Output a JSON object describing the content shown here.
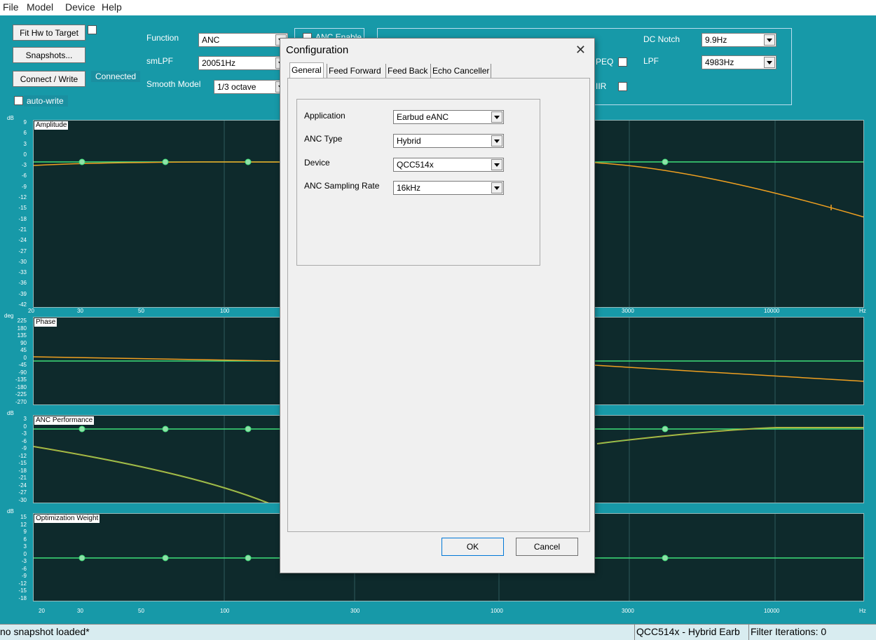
{
  "menubar": {
    "items": [
      "File",
      "Model",
      "Device",
      "Help"
    ]
  },
  "toolbar": {
    "fit_hw_label": "Fit Hw to Target",
    "snapshots_label": "Snapshots...",
    "connect_label": "Connect / Write",
    "connected_text": "Connected",
    "auto_write_label": "auto-write",
    "function_label": "Function",
    "function_value": "ANC",
    "smlpf_label": "smLPF",
    "smlpf_value": "20051Hz",
    "smooth_label": "Smooth Model",
    "smooth_value": "1/3 octave",
    "anc_enable_label": "ANC Enable",
    "peq_label": "PEQ",
    "iir_label": "IIR",
    "dc_notch_label": "DC Notch",
    "dc_notch_value": "9.9Hz",
    "lpf_label": "LPF",
    "lpf_value": "4983Hz"
  },
  "plots": {
    "amplitude": {
      "title": "Amplitude",
      "unit": "dB",
      "yticks": [
        "9",
        "6",
        "3",
        "0",
        "-3",
        "-6",
        "-9",
        "-12",
        "-15",
        "-18",
        "-21",
        "-24",
        "-27",
        "-30",
        "-33",
        "-36",
        "-39",
        "-42"
      ]
    },
    "phase": {
      "title": "Phase",
      "unit": "deg",
      "yticks": [
        "225",
        "180",
        "135",
        "90",
        "45",
        "0",
        "-45",
        "-90",
        "-135",
        "-180",
        "-225",
        "-270"
      ]
    },
    "anc": {
      "title": "ANC Performance",
      "unit": "dB",
      "yticks": [
        "3",
        "0",
        "-3",
        "-6",
        "-9",
        "-12",
        "-15",
        "-18",
        "-21",
        "-24",
        "-27",
        "-30"
      ]
    },
    "weight": {
      "title": "Optimization Weight",
      "unit": "dB",
      "yticks": [
        "15",
        "12",
        "9",
        "6",
        "3",
        "0",
        "-3",
        "-6",
        "-9",
        "-12",
        "-15",
        "-18"
      ]
    },
    "xticks_amp": [
      "20",
      "30",
      "50",
      "100",
      "3000",
      "10000",
      "Hz"
    ],
    "xticks_bottom": [
      "20",
      "30",
      "50",
      "100",
      "300",
      "1000",
      "3000",
      "10000",
      "Hz"
    ],
    "colors": {
      "grid": "#2d5a5c",
      "line_green": "#3fe07a",
      "line_orange": "#f0a020",
      "bg": "#0e2a2c"
    }
  },
  "dialog": {
    "title": "Configuration",
    "tabs": [
      "General",
      "Feed Forward",
      "Feed Back",
      "Echo Canceller"
    ],
    "fields": [
      {
        "label": "Application",
        "value": "Earbud eANC"
      },
      {
        "label": "ANC Type",
        "value": "Hybrid"
      },
      {
        "label": "Device",
        "value": "QCC514x"
      },
      {
        "label": "ANC Sampling Rate",
        "value": "16kHz"
      }
    ],
    "ok_label": "OK",
    "cancel_label": "Cancel"
  },
  "status": {
    "snapshot": "no snapshot loaded*",
    "device": "QCC514x - Hybrid Earb",
    "iterations": "Filter Iterations: 0"
  }
}
